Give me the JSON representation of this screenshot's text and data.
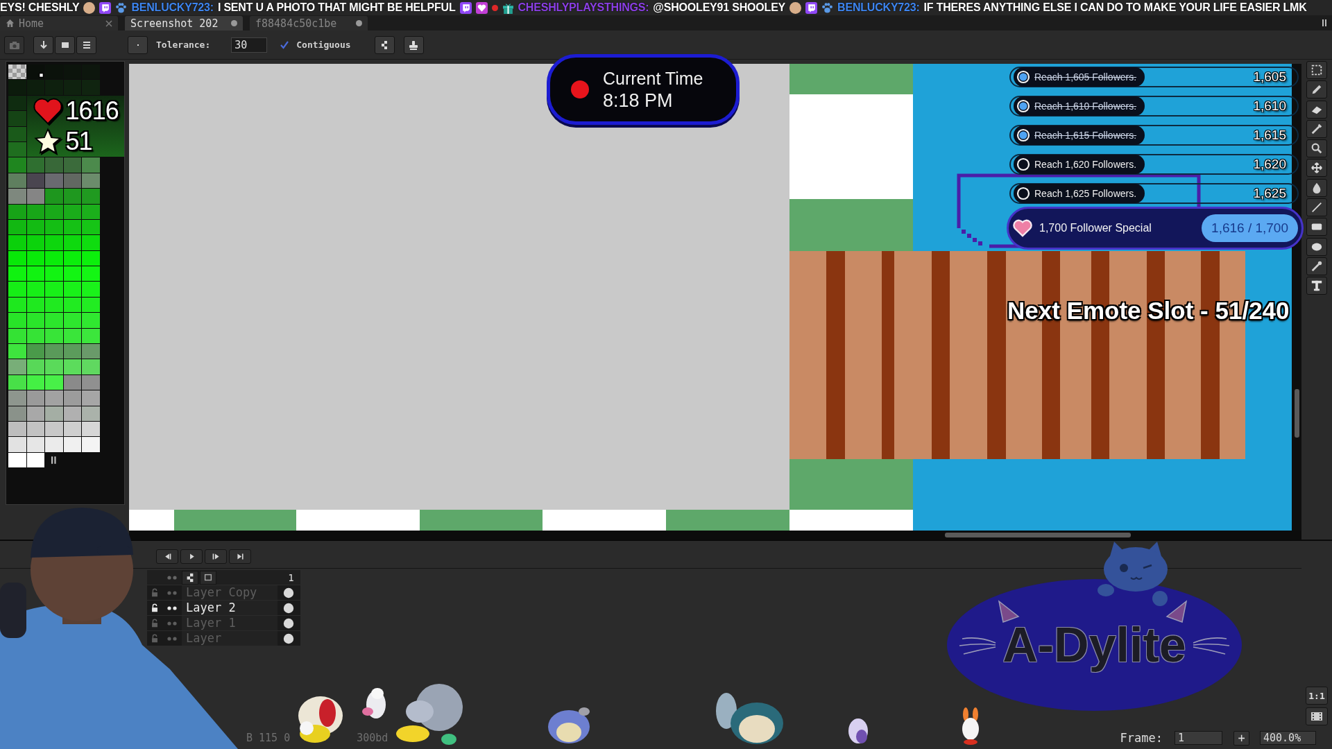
{
  "ticker": [
    {
      "kind": "message",
      "text": "EYS! CHESHLY"
    },
    {
      "kind": "emote"
    },
    {
      "kind": "badge"
    },
    {
      "kind": "paw"
    },
    {
      "kind": "user",
      "text": "BENLUCKY723:",
      "color": "#3d85f0"
    },
    {
      "kind": "message",
      "text": "I SENT U A PHOTO THAT MIGHT BE HELPFUL"
    },
    {
      "kind": "badge"
    },
    {
      "kind": "gem"
    },
    {
      "kind": "dot"
    },
    {
      "kind": "gift"
    },
    {
      "kind": "user",
      "text": "CHESHLYPLAYSTHINGS:",
      "color": "#8b3fe6"
    },
    {
      "kind": "message",
      "text": "@SHOOLEY91 SHOOLEY"
    },
    {
      "kind": "emote"
    },
    {
      "kind": "badge"
    },
    {
      "kind": "paw"
    },
    {
      "kind": "user",
      "text": "BENLUCKY723:",
      "color": "#3d85f0"
    },
    {
      "kind": "message",
      "text": "IF THERES ANYTHING ELSE I CAN DO TO MAKE YOUR LIFE EASIER LMK"
    }
  ],
  "tabs": [
    {
      "label": "Home",
      "kind": "home",
      "modified": false,
      "selected": false
    },
    {
      "label": "Screenshot 202",
      "kind": "file",
      "modified": true,
      "selected": true
    },
    {
      "label": "f88484c50c1be",
      "kind": "file",
      "modified": true,
      "selected": false
    }
  ],
  "toolbar": {
    "tolerance_label": "Tolerance:",
    "tolerance": "30",
    "contiguous": {
      "label": "Contiguous",
      "checked": true
    }
  },
  "palette": {
    "swatches": [
      {
        "kind": "transparent",
        "selected": false
      },
      {
        "kind": "solid",
        "color": "#0a0f0a",
        "selected": true
      },
      {
        "kind": "solid",
        "color": "#0b120b",
        "selected": false
      },
      {
        "kind": "solid",
        "color": "#0c140c",
        "selected": false
      },
      {
        "kind": "solid",
        "color": "#0d160d",
        "selected": false
      },
      {
        "kind": "solid",
        "color": "#0c1b0c",
        "selected": false
      },
      {
        "kind": "solid",
        "color": "#0d1e0d",
        "selected": false
      },
      {
        "kind": "solid",
        "color": "#0e200e",
        "selected": false
      },
      {
        "kind": "solid",
        "color": "#0f220f",
        "selected": false
      },
      {
        "kind": "solid",
        "color": "#102410",
        "selected": false
      },
      {
        "kind": "solid",
        "color": "#0f2c10",
        "selected": false
      },
      {
        "kind": "solid",
        "color": "#154415",
        "selected": false
      },
      {
        "kind": "solid",
        "color": "#1a5a1a",
        "selected": false
      },
      {
        "kind": "solid",
        "color": "#1f6e1f",
        "selected": false
      },
      {
        "kind": "solid",
        "color": "#1f861f",
        "selected": false
      },
      {
        "kind": "solid",
        "color": "#2f6f30",
        "selected": false
      },
      {
        "kind": "solid",
        "color": "#386838",
        "selected": false
      },
      {
        "kind": "solid",
        "color": "#3b6b3b",
        "selected": false
      },
      {
        "kind": "solid",
        "color": "#4c8a4c",
        "selected": false
      },
      {
        "kind": "solid",
        "color": "#5f7f5f",
        "selected": false
      },
      {
        "kind": "solid",
        "color": "#4a4550",
        "selected": false
      },
      {
        "kind": "solid",
        "color": "#6a6a70",
        "selected": false
      },
      {
        "kind": "solid",
        "color": "#626862",
        "selected": false
      },
      {
        "kind": "solid",
        "color": "#6c8c6c",
        "selected": false
      },
      {
        "kind": "solid",
        "color": "#7e887e",
        "selected": false
      },
      {
        "kind": "solid",
        "color": "#858585",
        "selected": false
      },
      {
        "kind": "solid",
        "color": "#1e961e",
        "selected": false
      },
      {
        "kind": "solid",
        "color": "#1f981f",
        "selected": false
      },
      {
        "kind": "solid",
        "color": "#209a20",
        "selected": false
      },
      {
        "kind": "solid",
        "color": "#17a317",
        "selected": false
      },
      {
        "kind": "solid",
        "color": "#18a618",
        "selected": false
      },
      {
        "kind": "solid",
        "color": "#19a919",
        "selected": false
      },
      {
        "kind": "solid",
        "color": "#1aac1a",
        "selected": false
      },
      {
        "kind": "solid",
        "color": "#1baf1b",
        "selected": false
      },
      {
        "kind": "solid",
        "color": "#12b812",
        "selected": false
      },
      {
        "kind": "solid",
        "color": "#13bb13",
        "selected": false
      },
      {
        "kind": "solid",
        "color": "#14be14",
        "selected": false
      },
      {
        "kind": "solid",
        "color": "#15c115",
        "selected": false
      },
      {
        "kind": "solid",
        "color": "#16c416",
        "selected": false
      },
      {
        "kind": "solid",
        "color": "#0bd00b",
        "selected": false
      },
      {
        "kind": "solid",
        "color": "#0cd30c",
        "selected": false
      },
      {
        "kind": "solid",
        "color": "#0dd60d",
        "selected": false
      },
      {
        "kind": "solid",
        "color": "#0ed90e",
        "selected": false
      },
      {
        "kind": "solid",
        "color": "#0fdc0f",
        "selected": false
      },
      {
        "kind": "solid",
        "color": "#08e808",
        "selected": false
      },
      {
        "kind": "solid",
        "color": "#09ea09",
        "selected": false
      },
      {
        "kind": "solid",
        "color": "#0aec0a",
        "selected": false
      },
      {
        "kind": "solid",
        "color": "#0bee0b",
        "selected": false
      },
      {
        "kind": "solid",
        "color": "#0cf00c",
        "selected": false
      },
      {
        "kind": "solid",
        "color": "#10f210",
        "selected": false
      },
      {
        "kind": "solid",
        "color": "#11f311",
        "selected": false
      },
      {
        "kind": "solid",
        "color": "#12f412",
        "selected": false
      },
      {
        "kind": "solid",
        "color": "#13f513",
        "selected": false
      },
      {
        "kind": "solid",
        "color": "#14f614",
        "selected": false
      },
      {
        "kind": "solid",
        "color": "#16ee16",
        "selected": false
      },
      {
        "kind": "solid",
        "color": "#17ef17",
        "selected": false
      },
      {
        "kind": "solid",
        "color": "#18f018",
        "selected": false
      },
      {
        "kind": "solid",
        "color": "#19f119",
        "selected": false
      },
      {
        "kind": "solid",
        "color": "#1af21a",
        "selected": false
      },
      {
        "kind": "solid",
        "color": "#1ee81e",
        "selected": false
      },
      {
        "kind": "solid",
        "color": "#1fe91f",
        "selected": false
      },
      {
        "kind": "solid",
        "color": "#20ea20",
        "selected": false
      },
      {
        "kind": "solid",
        "color": "#21eb21",
        "selected": false
      },
      {
        "kind": "solid",
        "color": "#22ec22",
        "selected": false
      },
      {
        "kind": "solid",
        "color": "#28e428",
        "selected": false
      },
      {
        "kind": "solid",
        "color": "#2ae52a",
        "selected": false
      },
      {
        "kind": "solid",
        "color": "#2ce62c",
        "selected": false
      },
      {
        "kind": "solid",
        "color": "#2ee72e",
        "selected": false
      },
      {
        "kind": "solid",
        "color": "#30e830",
        "selected": false
      },
      {
        "kind": "solid",
        "color": "#34e234",
        "selected": false
      },
      {
        "kind": "solid",
        "color": "#36e336",
        "selected": false
      },
      {
        "kind": "solid",
        "color": "#38e438",
        "selected": false
      },
      {
        "kind": "solid",
        "color": "#3ae53a",
        "selected": false
      },
      {
        "kind": "solid",
        "color": "#3ce63c",
        "selected": false
      },
      {
        "kind": "solid",
        "color": "#3ee43e",
        "selected": false
      },
      {
        "kind": "solid",
        "color": "#4a9a4a",
        "selected": false
      },
      {
        "kind": "solid",
        "color": "#5a9a5a",
        "selected": false
      },
      {
        "kind": "solid",
        "color": "#5c9c5c",
        "selected": false
      },
      {
        "kind": "solid",
        "color": "#6a9a6a",
        "selected": false
      },
      {
        "kind": "solid",
        "color": "#78ae78",
        "selected": false
      },
      {
        "kind": "solid",
        "color": "#58d858",
        "selected": false
      },
      {
        "kind": "solid",
        "color": "#5ada5a",
        "selected": false
      },
      {
        "kind": "solid",
        "color": "#5cdc5c",
        "selected": false
      },
      {
        "kind": "solid",
        "color": "#60d860",
        "selected": false
      },
      {
        "kind": "solid",
        "color": "#48e048",
        "selected": false
      },
      {
        "kind": "solid",
        "color": "#44f044",
        "selected": false
      },
      {
        "kind": "solid",
        "color": "#48f048",
        "selected": false
      },
      {
        "kind": "solid",
        "color": "#8a8a8a",
        "selected": false
      },
      {
        "kind": "solid",
        "color": "#909090",
        "selected": false
      },
      {
        "kind": "solid",
        "color": "#8e968e",
        "selected": false
      },
      {
        "kind": "solid",
        "color": "#9a9a9a",
        "selected": false
      },
      {
        "kind": "solid",
        "color": "#a2a2a2",
        "selected": false
      },
      {
        "kind": "solid",
        "color": "#9c9c9c",
        "selected": false
      },
      {
        "kind": "solid",
        "color": "#a6a6a6",
        "selected": false
      },
      {
        "kind": "solid",
        "color": "#8a928a",
        "selected": false
      },
      {
        "kind": "solid",
        "color": "#a8a8a8",
        "selected": false
      },
      {
        "kind": "solid",
        "color": "#a4aea4",
        "selected": false
      },
      {
        "kind": "solid",
        "color": "#b0b0b0",
        "selected": false
      },
      {
        "kind": "solid",
        "color": "#aab2aa",
        "selected": false
      },
      {
        "kind": "solid",
        "color": "#bdbdbd",
        "selected": false
      },
      {
        "kind": "solid",
        "color": "#c2c2c2",
        "selected": false
      },
      {
        "kind": "solid",
        "color": "#c8c8c8",
        "selected": false
      },
      {
        "kind": "solid",
        "color": "#cfcfcf",
        "selected": false
      },
      {
        "kind": "solid",
        "color": "#d6d6d6",
        "selected": false
      },
      {
        "kind": "solid",
        "color": "#e2e2e2",
        "selected": false
      },
      {
        "kind": "solid",
        "color": "#e6e6e6",
        "selected": false
      },
      {
        "kind": "solid",
        "color": "#ebebeb",
        "selected": false
      },
      {
        "kind": "solid",
        "color": "#f0f0f0",
        "selected": false
      },
      {
        "kind": "solid",
        "color": "#f4f4f4",
        "selected": false
      },
      {
        "kind": "solid",
        "color": "#ffffff",
        "selected": false
      },
      {
        "kind": "solid",
        "color": "#fefefe",
        "selected": false
      }
    ]
  },
  "counters": [
    {
      "kind": "heart",
      "value": "1616"
    },
    {
      "kind": "star",
      "value": "51"
    }
  ],
  "clock": {
    "title": "Current Time",
    "time": "8:18 PM"
  },
  "goals": {
    "items": [
      {
        "label": "Reach 1,605 Followers.",
        "target": "1,605",
        "done": true
      },
      {
        "label": "Reach 1,610 Followers.",
        "target": "1,610",
        "done": true
      },
      {
        "label": "Reach 1,615 Followers.",
        "target": "1,615",
        "done": true
      },
      {
        "label": "Reach 1,620 Followers.",
        "target": "1,620",
        "done": false
      },
      {
        "label": "Reach 1,625 Followers.",
        "target": "1,625",
        "done": false
      }
    ],
    "special": {
      "label": "1,700 Follower Special",
      "progress": "1,616 / 1,700"
    }
  },
  "emote_slot": "Next Emote Slot - 51/240",
  "timeline": {
    "frame_header": "1",
    "zoom_reset": "1:1",
    "layers": [
      {
        "name": "Layer Copy",
        "selected": false
      },
      {
        "name": "Layer 2",
        "selected": true
      },
      {
        "name": "Layer 1",
        "selected": false
      },
      {
        "name": "Layer",
        "selected": false
      }
    ]
  },
  "status_bar": {
    "color_readout": "B 115 0",
    "hex_readout": "300bd",
    "frame_label": "Frame:",
    "frame": "1",
    "add_frame": "+",
    "zoom": "400.0%"
  },
  "logo": {
    "text": "A-Dylite"
  }
}
